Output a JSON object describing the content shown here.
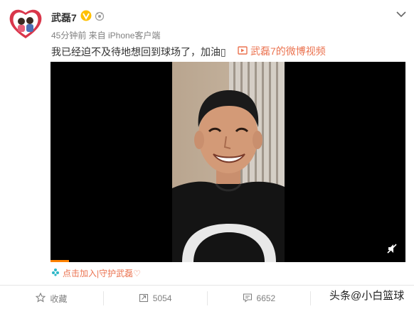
{
  "post": {
    "username": "武磊7",
    "meta": "45分钟前 来自 iPhone客户端",
    "text": "我已经迫不及待地想回到球场了，加油▯",
    "video_link": "武磊7的微博视频",
    "join_link": "点击加入|守护武磊♡"
  },
  "icons": {
    "vip": "vip-badge-icon",
    "level": "level-badge-icon",
    "chevron": "chevron-down-icon",
    "video": "video-icon",
    "mute": "mute-icon",
    "star": "star-icon",
    "repost": "repost-icon",
    "comment": "comment-icon"
  },
  "actions": {
    "favorite_label": "收藏",
    "repost_count": "5054",
    "comment_count": "6652",
    "like_count": ""
  },
  "watermark": "头条@小白篮球",
  "colors": {
    "accent": "#eb7350",
    "badge": "#ffc000",
    "progress": "#ff8200",
    "muted": "#808080"
  }
}
